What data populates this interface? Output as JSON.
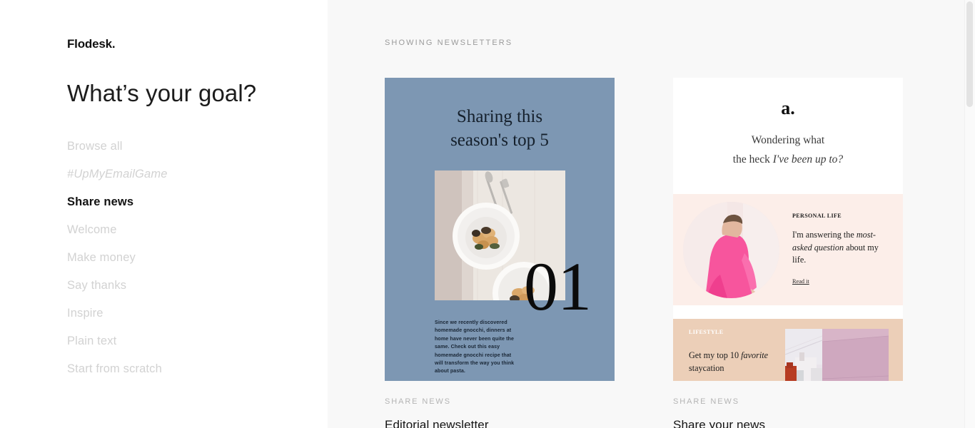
{
  "brand": {
    "logo": "Flodesk.",
    "accent_slate": "#7D97B3",
    "accent_pink": "#FCEEE9",
    "accent_peach": "#ECCFB8",
    "text_muted": "#D2D2D2",
    "text_dark": "#121212"
  },
  "sidebar": {
    "heading": "What’s your goal?",
    "items": [
      {
        "label": "Browse all",
        "active": false,
        "italic": false
      },
      {
        "label": "#UpMyEmailGame",
        "active": false,
        "italic": true
      },
      {
        "label": "Share news",
        "active": true,
        "italic": false
      },
      {
        "label": "Welcome",
        "active": false,
        "italic": false
      },
      {
        "label": "Make money",
        "active": false,
        "italic": false
      },
      {
        "label": "Say thanks",
        "active": false,
        "italic": false
      },
      {
        "label": "Inspire",
        "active": false,
        "italic": false
      },
      {
        "label": "Plain text",
        "active": false,
        "italic": false
      },
      {
        "label": "Start from scratch",
        "active": false,
        "italic": false
      }
    ]
  },
  "main": {
    "showing_label": "SHOWING NEWSLETTERS",
    "cards": [
      {
        "category": "SHARE NEWS",
        "title": "Editorial newsletter",
        "preview": {
          "headline_line1": "Sharing this",
          "headline_line2": "season's top 5",
          "number": "01",
          "body": "Since we recently discovered homemade gnocchi, dinners at home have never been quite the same. Check out this easy homemade gnocchi recipe that will transform the way you think about pasta.",
          "photo_alt": "bowls-of-gnocchi-on-linen-tablecloth"
        }
      },
      {
        "category": "SHARE NEWS",
        "title": "Share your news",
        "preview": {
          "logo": "a.",
          "sub_line1": "Wondering what",
          "sub_line2_plain": "the heck ",
          "sub_line2_italic": "I've been up to?",
          "section1_kicker": "PERSONAL LIFE",
          "section1_text_before": "I'm answering the ",
          "section1_text_italic": "most-asked question",
          "section1_text_after": " about my life.",
          "section1_link": "Read it",
          "section1_photo_alt": "woman-in-pink-sweater-circular-portrait",
          "section2_kicker": "LIFESTYLE",
          "section2_text_before": "Get my top 10 ",
          "section2_text_italic": "favorite",
          "section2_text_after": " staycation",
          "section2_photo_alt": "pink-wall-rooftops-photo"
        }
      }
    ]
  }
}
